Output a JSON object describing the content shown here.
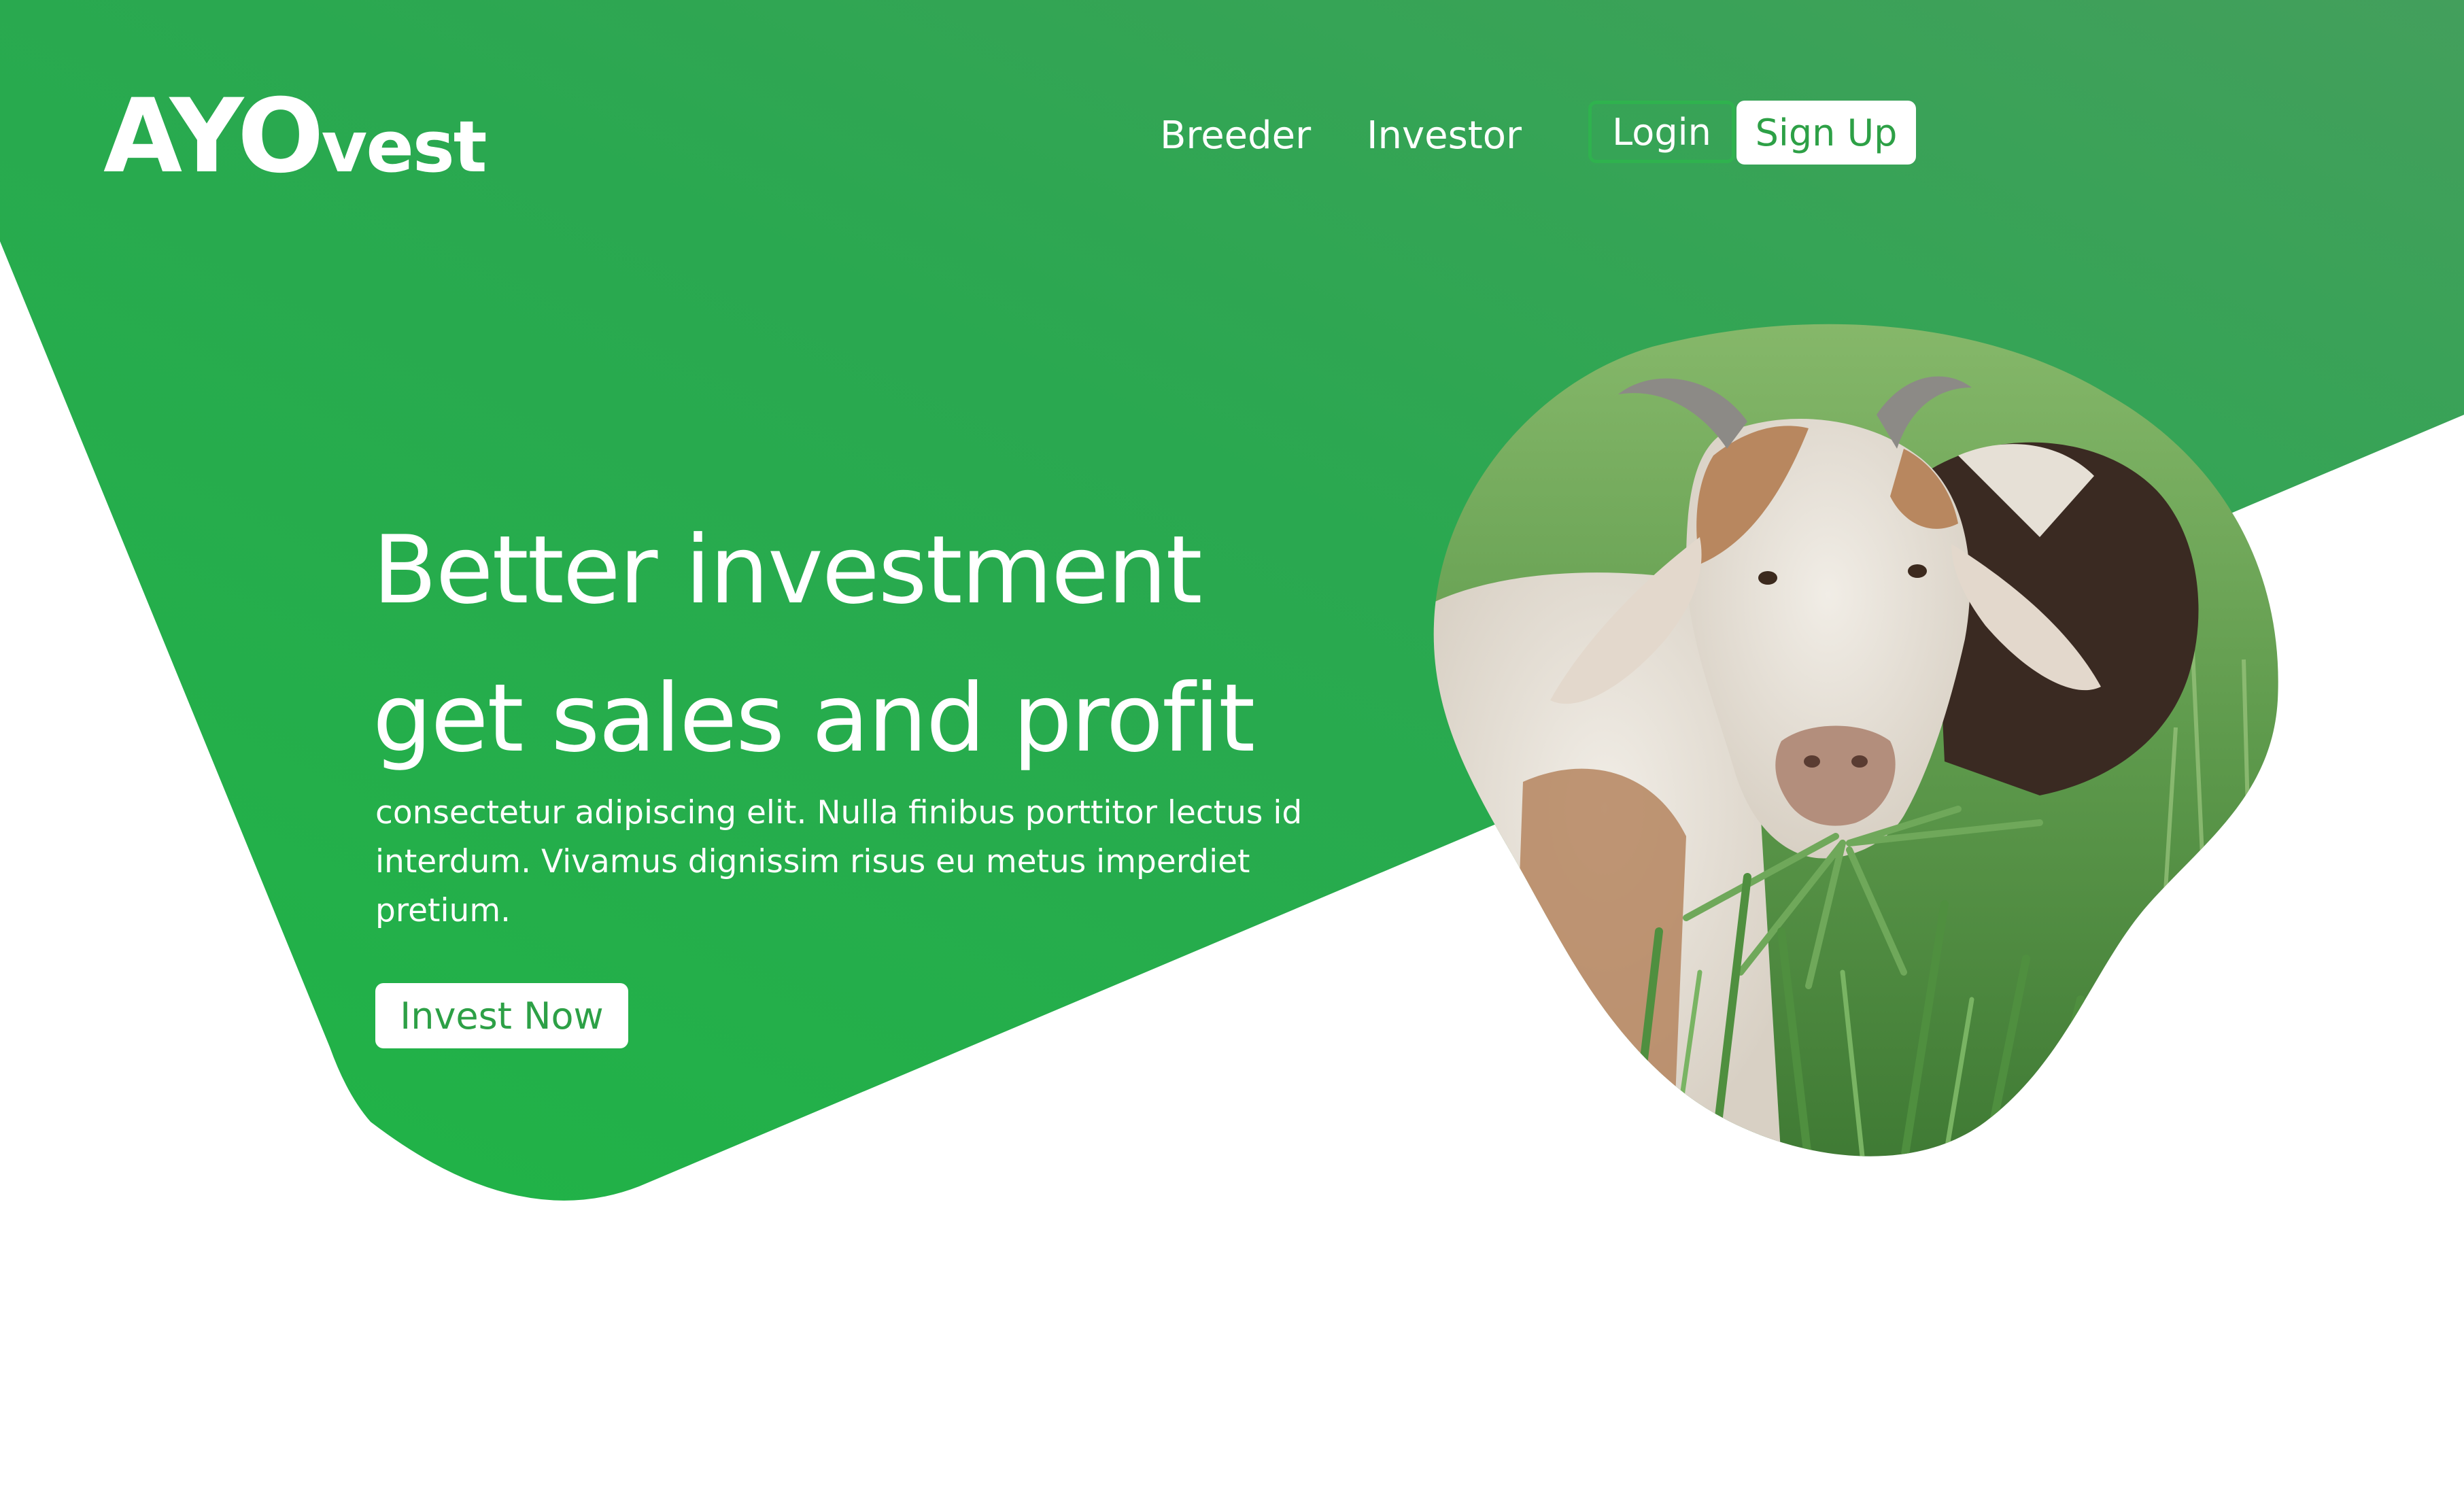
{
  "brand": {
    "logo_main": "AYO",
    "logo_sub": "vest"
  },
  "nav": {
    "items": [
      {
        "label": "Breeder"
      },
      {
        "label": "Investor"
      }
    ],
    "login_label": "Login",
    "signup_label": "Sign Up"
  },
  "hero": {
    "headline_line1": "Better investment",
    "headline_line2": "get sales and profit",
    "description": "consectetur adipiscing elit. Nulla finibus porttitor lectus id interdum. Vivamus dignissim risus eu metus imperdiet pretium.",
    "cta_label": "Invest Now"
  },
  "colors": {
    "primary_green": "#25b14a",
    "header_green": "#3d9f58",
    "background": "#ffffff",
    "button_text": "#2da046"
  },
  "icons": {
    "hero_image": "goat-photo"
  }
}
